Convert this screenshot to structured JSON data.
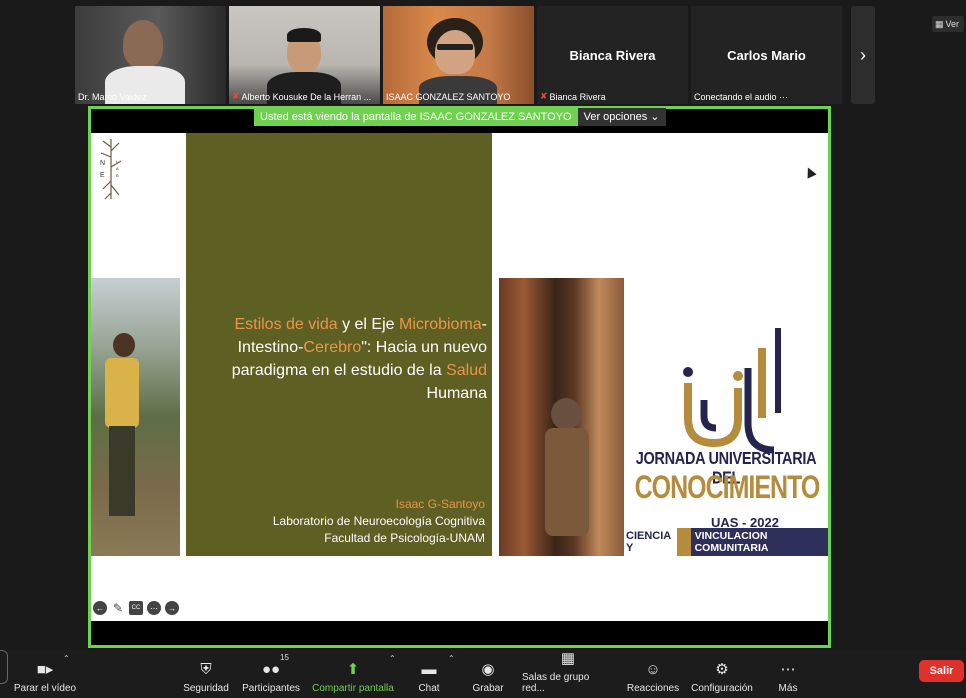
{
  "participants": [
    {
      "name": "Dr. Marco Valdez",
      "muted": false,
      "video": true
    },
    {
      "name": "Alberto Kousuke De la Herran ...",
      "muted": true,
      "video": true
    },
    {
      "name": "ISAAC GONZALEZ SANTOYO",
      "muted": false,
      "video": true,
      "active": true
    },
    {
      "name": "Bianca Rivera",
      "display_name": "Bianca Rivera",
      "muted": true,
      "video": false
    },
    {
      "name": "Conectando el audio ···",
      "display_name": "Carlos Mario",
      "muted": false,
      "video": false
    }
  ],
  "view_button": "Ver",
  "sharing": {
    "label": "Usted está viendo la pantalla de ISAAC GONZALEZ SANTOYO",
    "options": "Ver opciones"
  },
  "slide": {
    "logo_letters": "N E L A B",
    "title_parts": {
      "p1": "Estilos de vida",
      "p2": " y el Eje ",
      "p3": "Microbioma",
      "p4": "-Intestino-",
      "p5": "Cerebro",
      "p6": "\": Hacia un nuevo paradigma en el estudio de la ",
      "p7": "Salud",
      "p8": " Humana"
    },
    "author": "Isaac G-Santoyo",
    "lab": "Laboratorio de Neuroecología Cognitiva",
    "faculty": "Facultad de Psicología-UNAM",
    "jornada_line1": "JORNADA UNIVERSITARIA DEL",
    "jornada_line2": "CONOCIMIENTO",
    "jornada_uas": "UAS - 2022",
    "jornada_ciencia": "CIENCIA Y",
    "jornada_vinculacion": "VINCULACION COMUNITARIA"
  },
  "toolbar": {
    "video": "Parar el vídeo",
    "security": "Seguridad",
    "participants": "Participantes",
    "participants_count": "15",
    "share": "Compartir pantalla",
    "chat": "Chat",
    "record": "Grabar",
    "breakout": "Salas de grupo red...",
    "reactions": "Reacciones",
    "settings": "Configuración",
    "more": "Más",
    "leave": "Salir"
  },
  "colors": {
    "accent_green": "#6fd14f",
    "olive": "#5e5f23",
    "highlight_orange": "#e89648",
    "gold": "#b58b3e",
    "navy": "#24244e",
    "leave_red": "#e0312b"
  }
}
